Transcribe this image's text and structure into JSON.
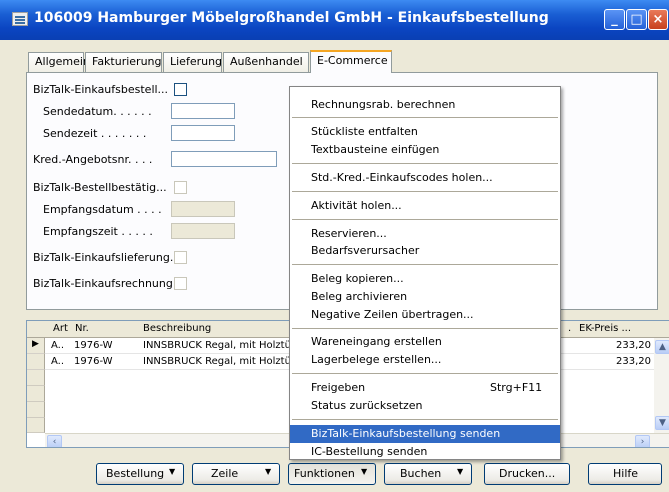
{
  "window": {
    "title": "106009 Hamburger Möbelgroßhandel GmbH - Einkaufsbestellung",
    "controls": {
      "minimize": "_",
      "maximize": "□",
      "close": "×"
    }
  },
  "tabs": [
    {
      "label": "Allgemein"
    },
    {
      "label": "Fakturierung"
    },
    {
      "label": "Lieferung"
    },
    {
      "label": "Außenhandel"
    },
    {
      "label": "E-Commerce",
      "active": true
    }
  ],
  "ecommerce": {
    "biztalk_einkaufsbestell": "BizTalk-Einkaufsbestell...",
    "sendedatum": "Sendedatum. . . . . .",
    "sendezeit": "Sendezeit . . . . . . .",
    "kred_angebotsnr": "Kred.-Angebotsnr. . . .",
    "biztalk_bestellbestaetig": "BizTalk-Bestellbestätig...",
    "empfangsdatum": "Empfangsdatum . . . .",
    "empfangszeit": "Empfangszeit . . . . .",
    "biztalk_einkaufslieferung": "BizTalk-Einkaufslieferung.",
    "biztalk_einkaufsrechnung": "BizTalk-Einkaufsrechnung"
  },
  "lines": {
    "columns": {
      "art": "Art",
      "nr": "Nr.",
      "beschreibung": "Beschreibung",
      "dot": ".",
      "ek_preis": "EK-Preis ..."
    },
    "rows": [
      {
        "art": "A..",
        "nr": "1976-W",
        "beschreibung": "INNSBRUCK Regal, mit Holztü",
        "ek_preis": "233,20",
        "current": true
      },
      {
        "art": "A..",
        "nr": "1976-W",
        "beschreibung": "INNSBRUCK Regal, mit Holztü",
        "ek_preis": "233,20"
      }
    ],
    "scroll_left": "‹",
    "scroll_right": "›"
  },
  "buttons": {
    "bestellung": "Bestellung",
    "zeile": "Zeile",
    "funktionen": "Funktionen",
    "buchen": "Buchen",
    "drucken": "Drucken...",
    "hilfe": "Hilfe",
    "caret": "▼"
  },
  "menu": {
    "items": [
      {
        "label": "Rechnungsrab. berechnen"
      },
      {
        "label": "Stückliste entfalten"
      },
      {
        "label": "Textbausteine einfügen"
      },
      {
        "label": "Std.-Kred.-Einkaufscodes holen..."
      },
      {
        "label": "Aktivität holen..."
      },
      {
        "label": "Reservieren..."
      },
      {
        "label": "Bedarfsverursacher"
      },
      {
        "label": "Beleg kopieren..."
      },
      {
        "label": "Beleg archivieren"
      },
      {
        "label": "Negative Zeilen übertragen..."
      },
      {
        "label": "Wareneingang erstellen"
      },
      {
        "label": "Lagerbelege erstellen..."
      },
      {
        "label": "Freigeben",
        "shortcut": "Strg+F11"
      },
      {
        "label": "Status zurücksetzen"
      },
      {
        "label": "BizTalk-Einkaufsbestellung senden",
        "highlighted": true
      },
      {
        "label": "IC-Bestellung senden"
      }
    ]
  },
  "colors": {
    "titlebar": "#0a3fb3",
    "menu_highlight": "#316ac5",
    "active_tab_accent": "#f5a623"
  }
}
